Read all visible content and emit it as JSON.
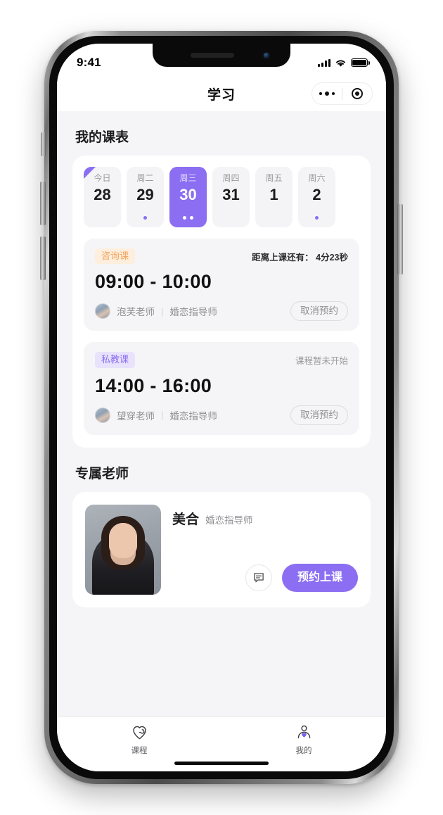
{
  "theme": {
    "accent": "#8b6ef2",
    "accent_soft": "#e8e2fd",
    "orange": "#f3a55c",
    "orange_soft": "#fdeedd",
    "page_bg": "#f5f5f7",
    "card_bg": "#ffffff"
  },
  "status_bar": {
    "time": "9:41",
    "signal_icon": "cellular-signal-icon",
    "wifi_icon": "wifi-icon",
    "battery_icon": "battery-full-icon"
  },
  "navbar": {
    "title": "学习",
    "capsule": {
      "menu_icon": "more-dots-icon",
      "target_icon": "target-circle-icon"
    }
  },
  "schedule_section": {
    "title": "我的课表",
    "dates": [
      {
        "dow": "今日",
        "num": "28",
        "selected": false,
        "today": true,
        "dots": 0
      },
      {
        "dow": "周二",
        "num": "29",
        "selected": false,
        "today": false,
        "dots": 1
      },
      {
        "dow": "周三",
        "num": "30",
        "selected": true,
        "today": false,
        "dots": 2
      },
      {
        "dow": "周四",
        "num": "31",
        "selected": false,
        "today": false,
        "dots": 0
      },
      {
        "dow": "周五",
        "num": "1",
        "selected": false,
        "today": false,
        "dots": 0
      },
      {
        "dow": "周六",
        "num": "2",
        "selected": false,
        "today": false,
        "dots": 1
      }
    ],
    "lessons": [
      {
        "badge": "咨询课",
        "badge_type": "consult",
        "status": "距离上课还有： 4分23秒",
        "status_muted": false,
        "time": "09:00 - 10:00",
        "teacher_name": "泡芙老师",
        "separator": "|",
        "teacher_role": "婚恋指导师",
        "action_label": "取消预约",
        "avatar_icon": "teacher-avatar"
      },
      {
        "badge": "私教课",
        "badge_type": "private",
        "status": "课程暂未开始",
        "status_muted": true,
        "time": "14:00 - 16:00",
        "teacher_name": "望穿老师",
        "separator": "|",
        "teacher_role": "婚恋指导师",
        "action_label": "取消预约",
        "avatar_icon": "teacher-avatar"
      }
    ]
  },
  "teacher_section": {
    "title": "专属老师",
    "teacher": {
      "photo_icon": "teacher-portrait",
      "name": "美合",
      "role": "婚恋指导师",
      "chat_icon": "message-bubble-icon",
      "book_label": "预约上课"
    }
  },
  "tabbar": {
    "tabs": [
      {
        "label": "课程",
        "icon": "heart-course-icon",
        "active": false
      },
      {
        "label": "我的",
        "icon": "person-heart-icon",
        "active": false
      }
    ]
  }
}
